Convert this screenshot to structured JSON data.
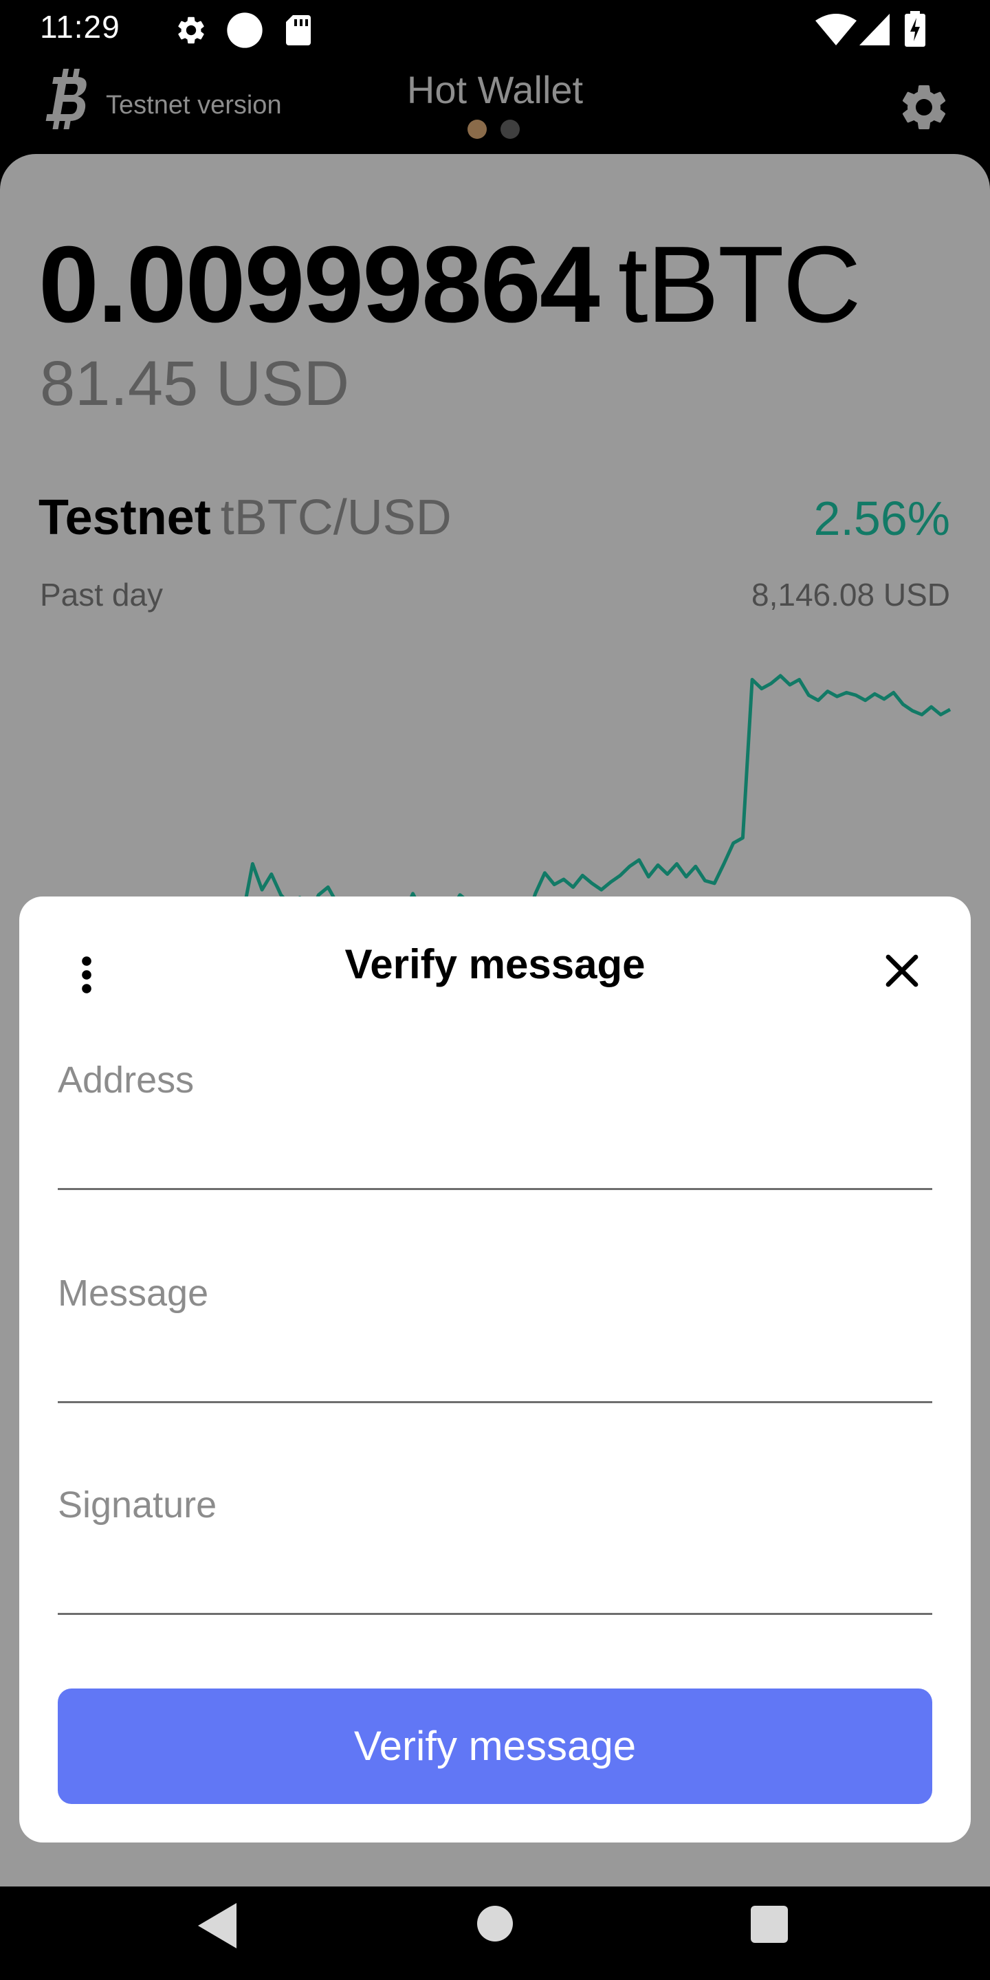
{
  "status_bar": {
    "time": "11:29",
    "left_icons": [
      "settings-icon",
      "circle-icon",
      "sd-card-icon"
    ],
    "right_icons": [
      "wifi-icon",
      "signal-icon",
      "battery-charging-icon"
    ]
  },
  "header": {
    "network_label": "Testnet version",
    "title": "Hot Wallet",
    "page_indicator": {
      "count": 2,
      "active_index": 0
    },
    "icons": {
      "logo": "bitcoin-logo-icon",
      "settings": "gear-icon"
    }
  },
  "wallet": {
    "balance_amount": "0.00999864",
    "balance_unit": "tBTC",
    "fiat_value": "81.45 USD",
    "market": {
      "network": "Testnet",
      "pair": "tBTC/USD",
      "change": "2.56%",
      "period": "Past day",
      "price": "8,146.08 USD"
    }
  },
  "chart_data": {
    "type": "line",
    "series": [
      {
        "color": "#127a66",
        "values": [
          6290,
          6320,
          6700,
          6500,
          6620,
          6460,
          6380,
          6440,
          6300,
          6460,
          6520,
          6390,
          6350,
          6280,
          6330,
          6240,
          6300,
          6250,
          6300,
          6470,
          6330,
          6250,
          6300,
          6340,
          6460,
          6400,
          6380,
          6420,
          6300,
          6260,
          6100,
          6250,
          6470,
          6630,
          6540,
          6580,
          6520,
          6610,
          6550,
          6500,
          6560,
          6610,
          6680,
          6730,
          6600,
          6690,
          6620,
          6700,
          6600,
          6680,
          6570,
          6550,
          6700,
          6860,
          6900,
          8120,
          8050,
          8090,
          8150,
          8080,
          8120,
          8000,
          7960,
          8030,
          7990,
          8020,
          8000,
          7960,
          8010,
          7970,
          8020,
          7930,
          7880,
          7850,
          7910,
          7850,
          7890
        ]
      }
    ],
    "color": "#127a66",
    "grid": false,
    "legend": "none"
  },
  "modal": {
    "title": "Verify message",
    "icons": {
      "menu": "more-vertical-icon",
      "close": "close-icon"
    },
    "fields": {
      "address": {
        "label": "Address",
        "value": ""
      },
      "message": {
        "label": "Message",
        "value": ""
      },
      "signature": {
        "label": "Signature",
        "value": ""
      }
    },
    "submit_label": "Verify message",
    "colors": {
      "button": "#6177f5"
    }
  },
  "nav_bar": {
    "icons": [
      "back-icon",
      "home-icon",
      "recents-icon"
    ]
  },
  "colors": {
    "positive": "#127a66",
    "card_dimmed": "#999999",
    "background": "#000000",
    "modal_background": "#ffffff"
  }
}
